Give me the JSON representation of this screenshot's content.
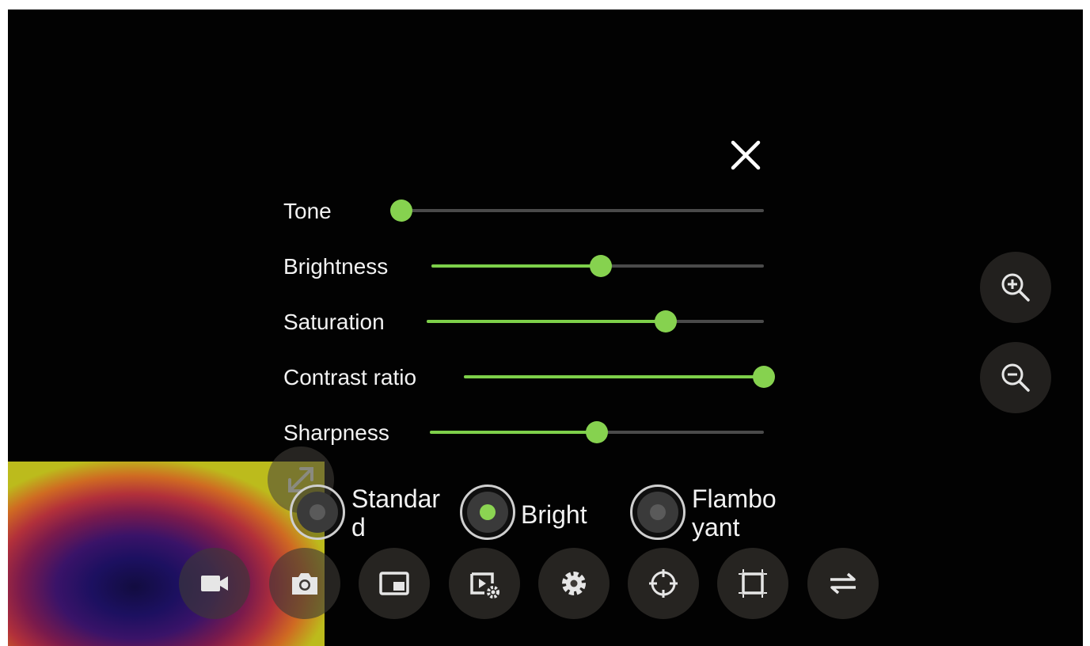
{
  "adjustments": {
    "sliders": [
      {
        "label": "Tone",
        "value": 0.0
      },
      {
        "label": "Brightness",
        "value": 0.51
      },
      {
        "label": "Saturation",
        "value": 0.71
      },
      {
        "label": "Contrast ratio",
        "value": 1.0
      },
      {
        "label": "Sharpness",
        "value": 0.5
      }
    ]
  },
  "modes": {
    "options": [
      {
        "label_line1": "Standar",
        "label_line2": "d",
        "selected": false
      },
      {
        "label": "Bright",
        "selected": true
      },
      {
        "label_line1": "Flambo",
        "label_line2": "yant",
        "selected": false
      }
    ]
  },
  "toolbar": {
    "buttons": [
      "video-camera-icon",
      "camera-icon",
      "picture-in-picture-icon",
      "playback-settings-icon",
      "gear-icon",
      "crosshair-icon",
      "crop-frame-icon",
      "swap-icon"
    ]
  },
  "zoom": {
    "buttons": [
      "zoom-in-icon",
      "zoom-out-icon"
    ]
  },
  "colors": {
    "accent": "#86d24f",
    "track": "#4a4a4a",
    "background": "#020202"
  }
}
